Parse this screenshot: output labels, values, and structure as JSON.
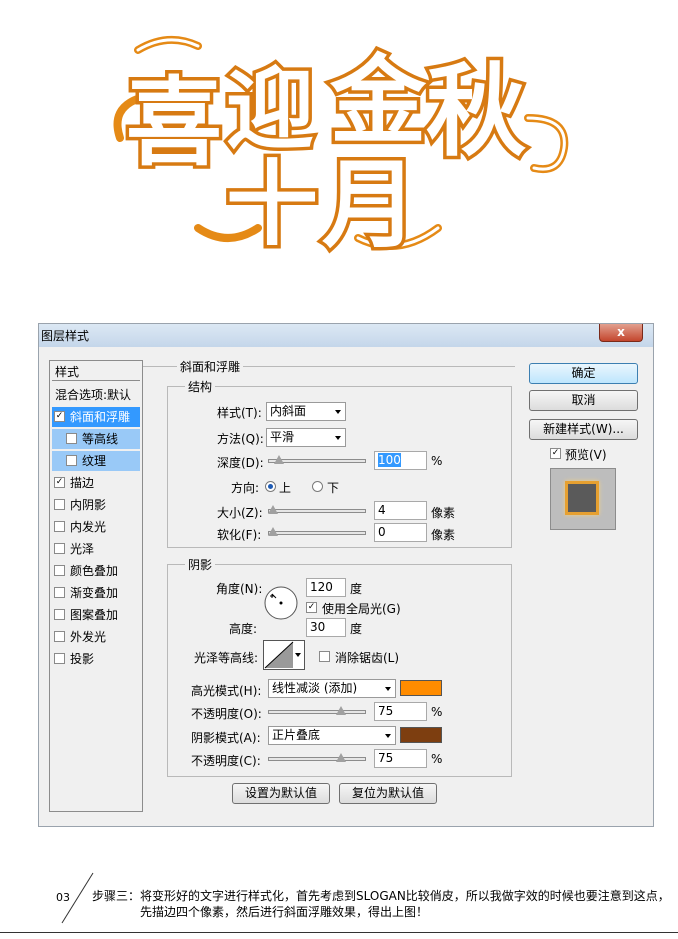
{
  "logo": {
    "line1": [
      "喜",
      "迎",
      "金",
      "秋"
    ],
    "line2": [
      "十",
      "月"
    ],
    "colors": {
      "outline": "#d77a12",
      "fill": "#ffffff"
    }
  },
  "dialog": {
    "title": "图层样式",
    "close_glyph": "x",
    "style_list": {
      "header": "样式",
      "items": [
        {
          "label": "混合选项:默认",
          "checkbox": false,
          "checked": false,
          "state": "normal"
        },
        {
          "label": "斜面和浮雕",
          "checkbox": true,
          "checked": true,
          "state": "selected"
        },
        {
          "label": "等高线",
          "checkbox": true,
          "checked": false,
          "state": "sub"
        },
        {
          "label": "纹理",
          "checkbox": true,
          "checked": false,
          "state": "sub"
        },
        {
          "label": "描边",
          "checkbox": true,
          "checked": true,
          "state": "normal"
        },
        {
          "label": "内阴影",
          "checkbox": true,
          "checked": false,
          "state": "normal"
        },
        {
          "label": "内发光",
          "checkbox": true,
          "checked": false,
          "state": "normal"
        },
        {
          "label": "光泽",
          "checkbox": true,
          "checked": false,
          "state": "normal"
        },
        {
          "label": "颜色叠加",
          "checkbox": true,
          "checked": false,
          "state": "normal"
        },
        {
          "label": "渐变叠加",
          "checkbox": true,
          "checked": false,
          "state": "normal"
        },
        {
          "label": "图案叠加",
          "checkbox": true,
          "checked": false,
          "state": "normal"
        },
        {
          "label": "外发光",
          "checkbox": true,
          "checked": false,
          "state": "normal"
        },
        {
          "label": "投影",
          "checkbox": true,
          "checked": false,
          "state": "normal"
        }
      ]
    },
    "bevel": {
      "group_title": "斜面和浮雕",
      "structure": {
        "title": "结构",
        "style_label": "样式(T):",
        "style_value": "内斜面",
        "technique_label": "方法(Q):",
        "technique_value": "平滑",
        "depth_label": "深度(D):",
        "depth_value": "100",
        "depth_unit": "%",
        "depth_slider_fraction": 0.1,
        "direction_label": "方向:",
        "direction_up": "上",
        "direction_down": "下",
        "size_label": "大小(Z):",
        "size_value": "4",
        "size_unit": "像素",
        "size_slider_fraction": 0.02,
        "soften_label": "软化(F):",
        "soften_value": "0",
        "soften_unit": "像素",
        "soften_slider_fraction": 0.0
      },
      "shading": {
        "title": "阴影",
        "angle_label": "角度(N):",
        "angle_value": "120",
        "angle_unit": "度",
        "global_light_label": "使用全局光(G)",
        "altitude_label": "高度:",
        "altitude_value": "30",
        "altitude_unit": "度",
        "gloss_contour_label": "光泽等高线:",
        "antialias_label": "消除锯齿(L)",
        "highlight_mode_label": "高光模式(H):",
        "highlight_mode_value": "线性减淡 (添加)",
        "highlight_color": "#ff8c00",
        "highlight_opacity_label": "不透明度(O):",
        "highlight_opacity_value": "75",
        "highlight_opacity_unit": "%",
        "highlight_slider_fraction": 0.75,
        "shadow_mode_label": "阴影模式(A):",
        "shadow_mode_value": "正片叠底",
        "shadow_color": "#7d3e10",
        "shadow_opacity_label": "不透明度(C):",
        "shadow_opacity_value": "75",
        "shadow_opacity_unit": "%",
        "shadow_slider_fraction": 0.75
      },
      "make_default_label": "设置为默认值",
      "reset_default_label": "复位为默认值"
    },
    "buttons": {
      "ok": "确定",
      "cancel": "取消",
      "new_style": "新建样式(W)...",
      "preview_label": "预览(V)"
    }
  },
  "caption": {
    "step_number": "03",
    "line1": "步骤三：将变形好的文字进行样式化，首先考虑到SLOGAN比较俏皮，所以我做字效的时候也要注意到这点，",
    "line2": "先描边四个像素，然后进行斜面浮雕效果，得出上图！"
  }
}
